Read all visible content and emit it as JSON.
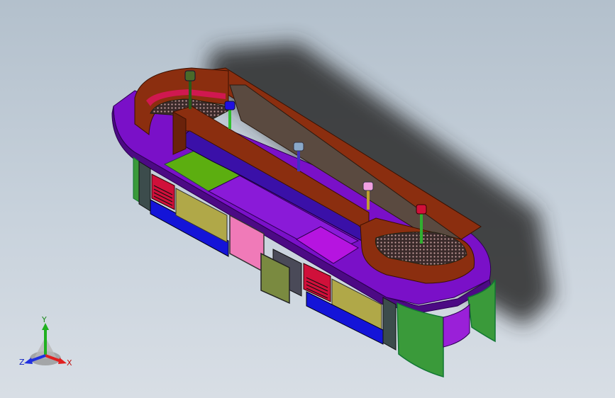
{
  "viewport": {
    "background_top": "#b3c0cc",
    "background_bottom": "#d8dee5"
  },
  "model": {
    "colors": {
      "wall_brown": "#8b2e0f",
      "wall_brown_dark": "#6a220b",
      "counter_purple": "#7a10c8",
      "counter_purple_dark": "#4c0a84",
      "panel_blue": "#1414d8",
      "panel_olive": "#b0a848",
      "door_pink": "#f07ab8",
      "pad_green": "#5cae10",
      "pad_magenta": "#b614e0",
      "side_green": "#3a9a3a",
      "drawer_olive": "#7a8a40",
      "accent_red": "#d0103a",
      "floor_shadow": "#2a2a2a"
    }
  },
  "triad": {
    "x_label": "X",
    "y_label": "Y",
    "z_label": "Z",
    "x_color": "#e02020",
    "y_color": "#20b020",
    "z_color": "#2030e0"
  }
}
